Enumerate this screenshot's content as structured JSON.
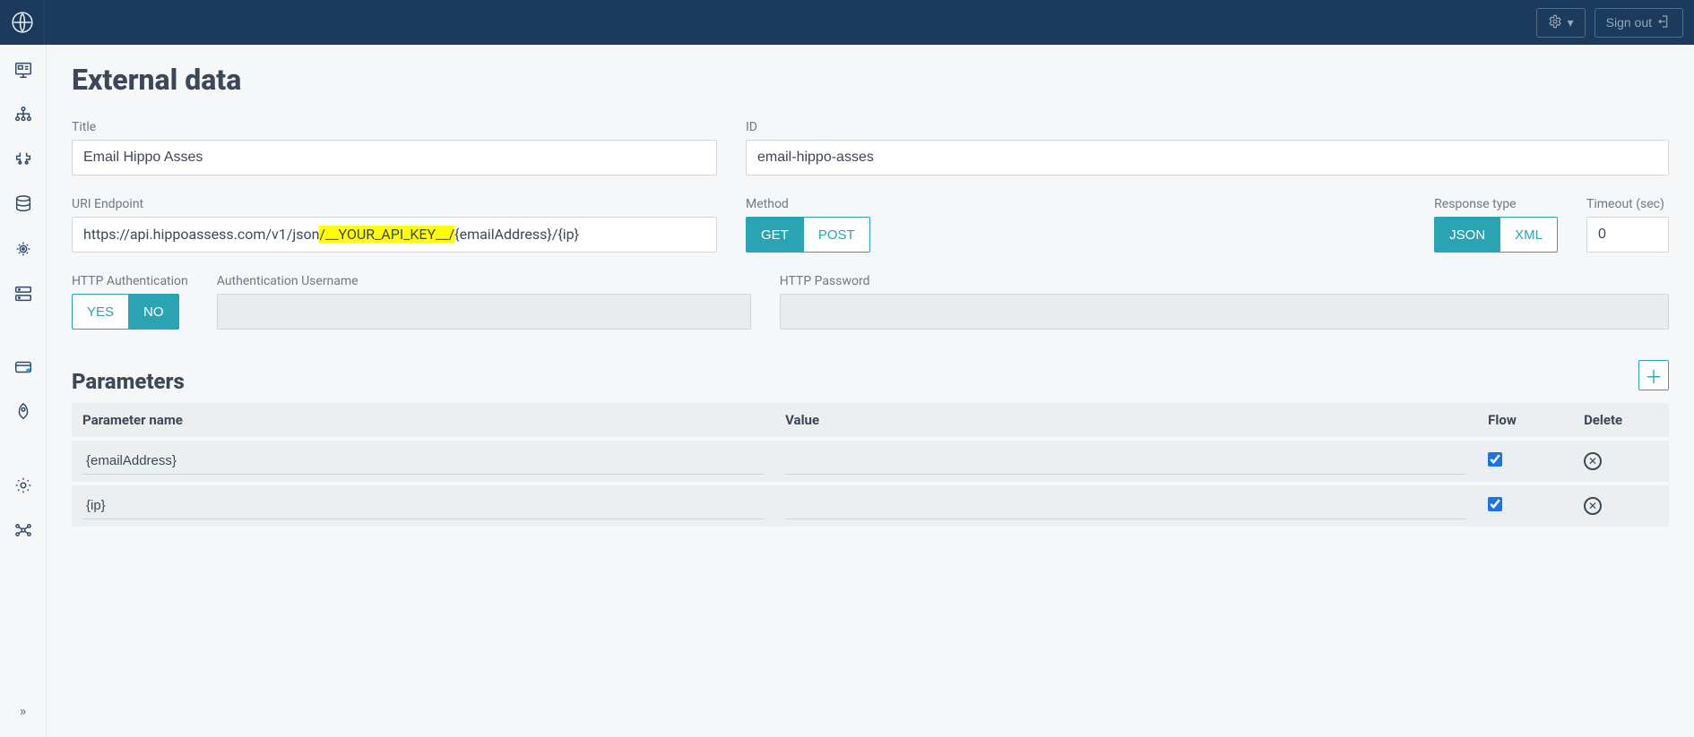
{
  "topbar": {
    "settings_label": "Settings",
    "signout_label": "Sign out"
  },
  "page": {
    "title": "External data"
  },
  "form": {
    "title_label": "Title",
    "title_value": "Email Hippo Asses",
    "id_label": "ID",
    "id_value": "email-hippo-asses",
    "uri_label": "URI Endpoint",
    "uri_prefix": "https://api.hippoassess.com/v1/json",
    "uri_highlight": "/__YOUR_API_KEY__/",
    "uri_suffix": "{emailAddress}/{ip}",
    "method_label": "Method",
    "method_options": {
      "get": "GET",
      "post": "POST"
    },
    "method_selected": "GET",
    "resp_label": "Response type",
    "resp_options": {
      "json": "JSON",
      "xml": "XML"
    },
    "resp_selected": "JSON",
    "timeout_label": "Timeout (sec)",
    "timeout_value": "0",
    "auth_label": "HTTP Authentication",
    "auth_options": {
      "yes": "YES",
      "no": "NO"
    },
    "auth_selected": "NO",
    "auth_user_label": "Authentication Username",
    "auth_user_value": "",
    "pass_label": "HTTP Password",
    "pass_value": ""
  },
  "params": {
    "section_title": "Parameters",
    "columns": {
      "name": "Parameter name",
      "value": "Value",
      "flow": "Flow",
      "delete": "Delete"
    },
    "rows": [
      {
        "name": "{emailAddress}",
        "value": "",
        "flow": true
      },
      {
        "name": "{ip}",
        "value": "",
        "flow": true
      }
    ]
  }
}
